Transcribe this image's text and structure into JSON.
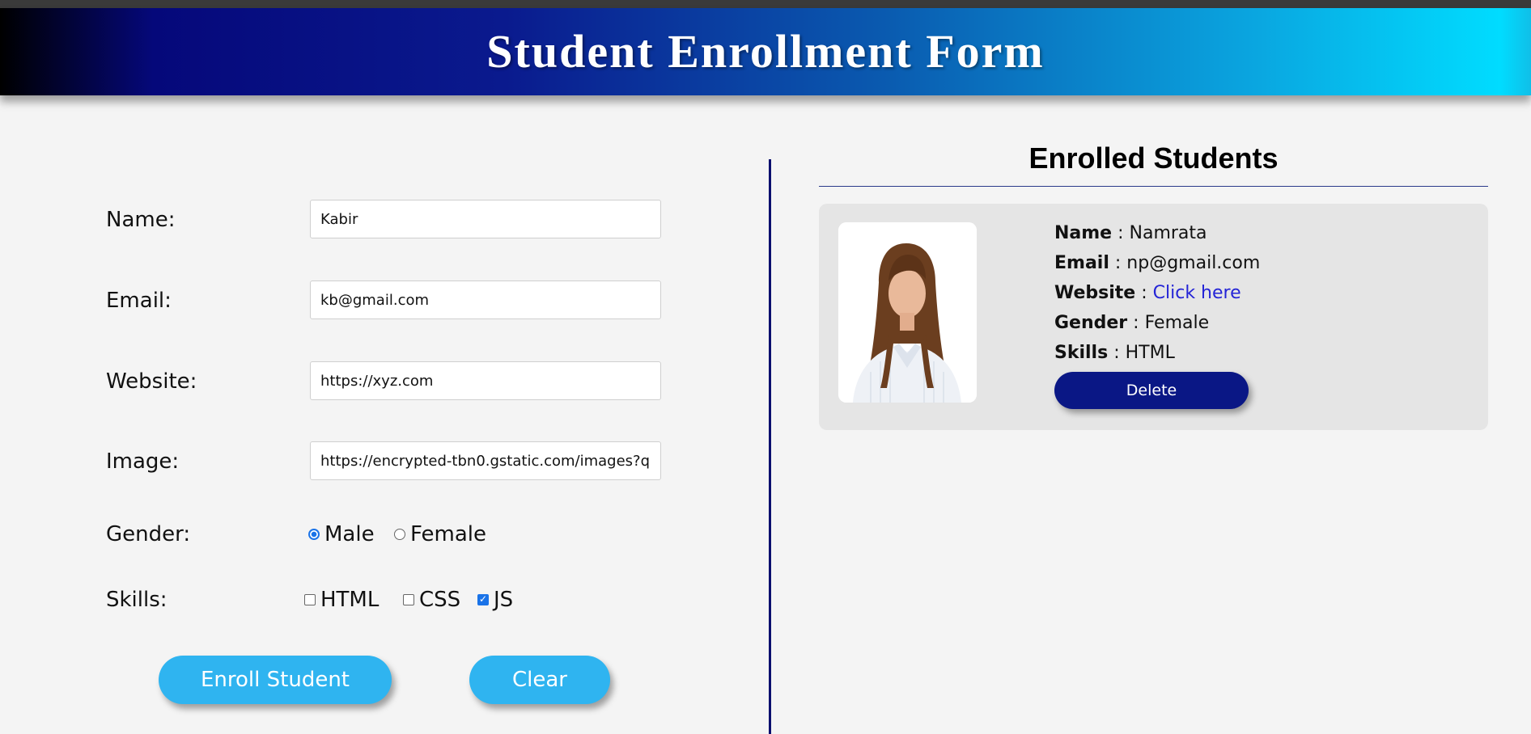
{
  "header": {
    "title": "Student Enrollment Form"
  },
  "form": {
    "name_label": "Name:",
    "name_value": "Kabir",
    "email_label": "Email:",
    "email_value": "kb@gmail.com",
    "website_label": "Website:",
    "website_value": "https://xyz.com",
    "image_label": "Image:",
    "image_value": "https://encrypted-tbn0.gstatic.com/images?q",
    "gender_label": "Gender:",
    "gender_options": [
      {
        "label": "Male",
        "checked": true
      },
      {
        "label": "Female",
        "checked": false
      }
    ],
    "skills_label": "Skills:",
    "skill_options": [
      {
        "label": "HTML",
        "checked": false
      },
      {
        "label": "CSS",
        "checked": false
      },
      {
        "label": "JS",
        "checked": true
      }
    ],
    "enroll_label": "Enroll Student",
    "clear_label": "Clear"
  },
  "enrolled": {
    "title": "Enrolled Students",
    "students": [
      {
        "name_key": "Name",
        "name": "Namrata",
        "email_key": "Email",
        "email": "np@gmail.com",
        "website_key": "Website",
        "website_link": "Click here",
        "gender_key": "Gender",
        "gender": "Female",
        "skills_key": "Skills",
        "skills": "HTML",
        "delete_label": "Delete"
      }
    ]
  },
  "colors": {
    "accent_button": "#2fb4f0",
    "delete_button": "#0a1785",
    "divider": "#0a0f6e",
    "link": "#2424d6"
  }
}
